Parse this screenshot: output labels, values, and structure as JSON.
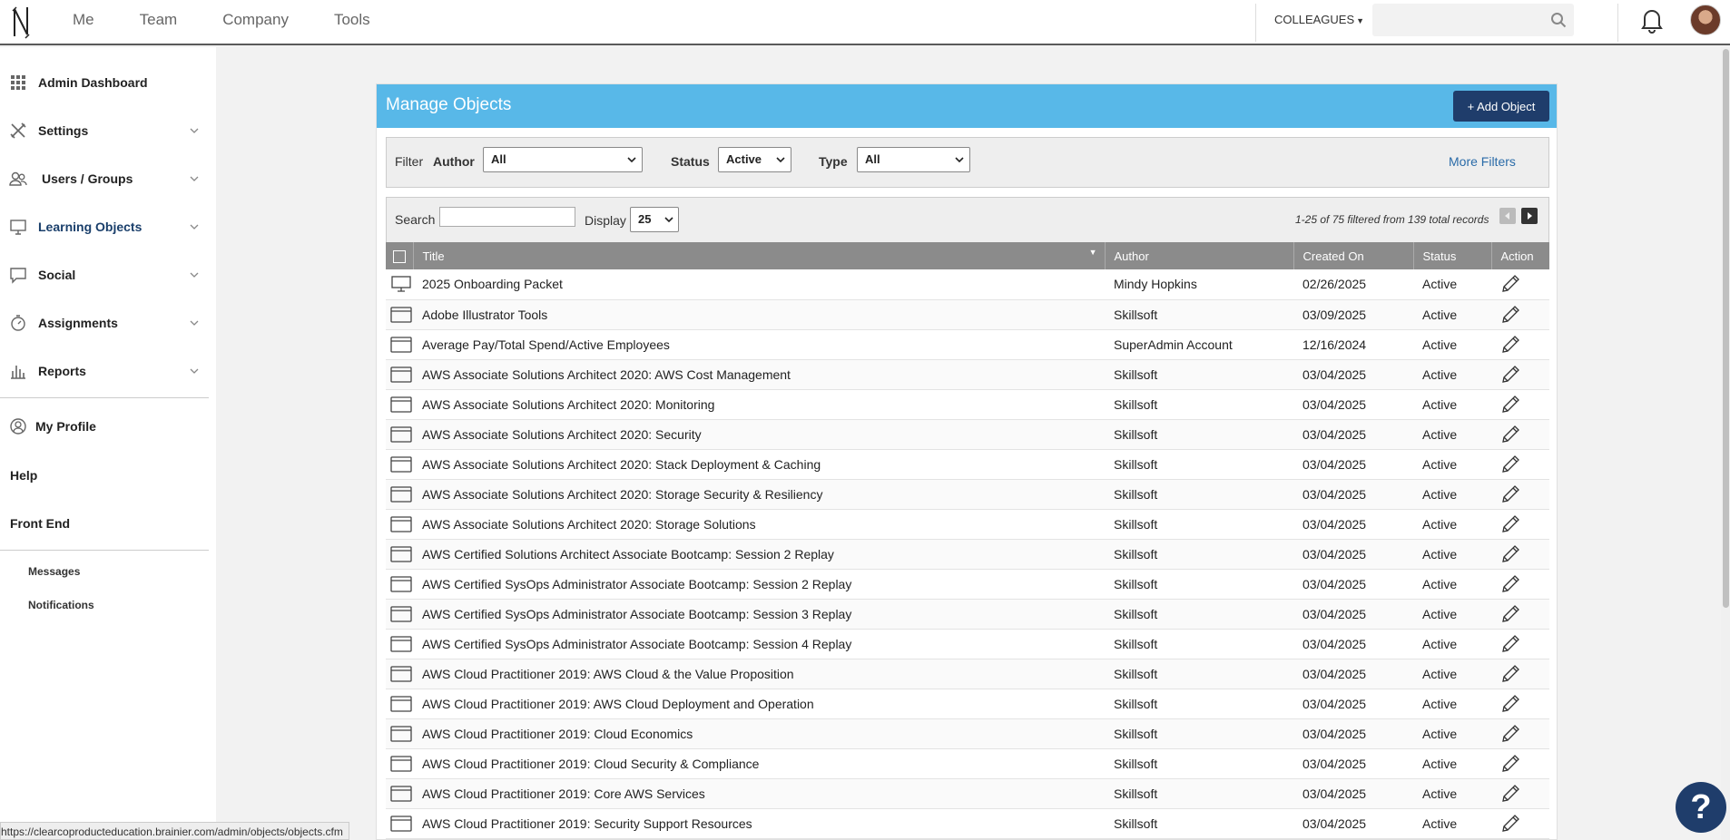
{
  "topnav": {
    "items": [
      "Me",
      "Team",
      "Company",
      "Tools"
    ],
    "colleagues_label": "COLLEAGUES",
    "search_placeholder": ""
  },
  "sidebar": {
    "items": [
      {
        "label": "Admin Dashboard",
        "icon": "grid-icon",
        "has_chevron": false
      },
      {
        "label": "Settings",
        "icon": "tools-icon",
        "has_chevron": true
      },
      {
        "label": "Users / Groups",
        "icon": "users-icon",
        "has_chevron": true
      },
      {
        "label": "Learning Objects",
        "icon": "monitor-icon",
        "has_chevron": true,
        "active": true
      },
      {
        "label": "Social",
        "icon": "chat-icon",
        "has_chevron": true
      },
      {
        "label": "Assignments",
        "icon": "stopwatch-icon",
        "has_chevron": true
      },
      {
        "label": "Reports",
        "icon": "bar-chart-icon",
        "has_chevron": true
      }
    ],
    "my_profile": "My Profile",
    "help": "Help",
    "front_end": "Front End",
    "messages": "Messages",
    "notifications": "Notifications"
  },
  "panel": {
    "title": "Manage Objects",
    "add_button": "+ Add Object",
    "filter": {
      "label": "Filter",
      "author_label": "Author",
      "author_value": "All",
      "status_label": "Status",
      "status_value": "Active",
      "type_label": "Type",
      "type_value": "All",
      "more_filters": "More Filters"
    },
    "search_label": "Search",
    "display_label": "Display",
    "display_value": "25",
    "records_text": "1-25 of 75 filtered from 139 total records"
  },
  "table": {
    "columns": [
      "Title",
      "Author",
      "Created On",
      "Status",
      "Action"
    ],
    "rows": [
      {
        "title": "2025 Onboarding Packet",
        "author": "Mindy Hopkins",
        "created": "02/26/2025",
        "status": "Active",
        "icon": "monitor-icon"
      },
      {
        "title": "Adobe Illustrator Tools",
        "author": "Skillsoft",
        "created": "03/09/2025",
        "status": "Active",
        "icon": "window-icon"
      },
      {
        "title": "Average Pay/Total Spend/Active Employees",
        "author": "SuperAdmin Account",
        "created": "12/16/2024",
        "status": "Active",
        "icon": "window-icon"
      },
      {
        "title": "AWS Associate Solutions Architect 2020: AWS Cost Management",
        "author": "Skillsoft",
        "created": "03/04/2025",
        "status": "Active",
        "icon": "window-icon"
      },
      {
        "title": "AWS Associate Solutions Architect 2020: Monitoring",
        "author": "Skillsoft",
        "created": "03/04/2025",
        "status": "Active",
        "icon": "window-icon"
      },
      {
        "title": "AWS Associate Solutions Architect 2020: Security",
        "author": "Skillsoft",
        "created": "03/04/2025",
        "status": "Active",
        "icon": "window-icon"
      },
      {
        "title": "AWS Associate Solutions Architect 2020: Stack Deployment & Caching",
        "author": "Skillsoft",
        "created": "03/04/2025",
        "status": "Active",
        "icon": "window-icon"
      },
      {
        "title": "AWS Associate Solutions Architect 2020: Storage Security & Resiliency",
        "author": "Skillsoft",
        "created": "03/04/2025",
        "status": "Active",
        "icon": "window-icon"
      },
      {
        "title": "AWS Associate Solutions Architect 2020: Storage Solutions",
        "author": "Skillsoft",
        "created": "03/04/2025",
        "status": "Active",
        "icon": "window-icon"
      },
      {
        "title": "AWS Certified Solutions Architect Associate Bootcamp: Session 2 Replay",
        "author": "Skillsoft",
        "created": "03/04/2025",
        "status": "Active",
        "icon": "window-icon"
      },
      {
        "title": "AWS Certified SysOps Administrator Associate Bootcamp: Session 2 Replay",
        "author": "Skillsoft",
        "created": "03/04/2025",
        "status": "Active",
        "icon": "window-icon"
      },
      {
        "title": "AWS Certified SysOps Administrator Associate Bootcamp: Session 3 Replay",
        "author": "Skillsoft",
        "created": "03/04/2025",
        "status": "Active",
        "icon": "window-icon"
      },
      {
        "title": "AWS Certified SysOps Administrator Associate Bootcamp: Session 4 Replay",
        "author": "Skillsoft",
        "created": "03/04/2025",
        "status": "Active",
        "icon": "window-icon"
      },
      {
        "title": "AWS Cloud Practitioner 2019: AWS Cloud & the Value Proposition",
        "author": "Skillsoft",
        "created": "03/04/2025",
        "status": "Active",
        "icon": "window-icon"
      },
      {
        "title": "AWS Cloud Practitioner 2019: AWS Cloud Deployment and Operation",
        "author": "Skillsoft",
        "created": "03/04/2025",
        "status": "Active",
        "icon": "window-icon"
      },
      {
        "title": "AWS Cloud Practitioner 2019: Cloud Economics",
        "author": "Skillsoft",
        "created": "03/04/2025",
        "status": "Active",
        "icon": "window-icon"
      },
      {
        "title": "AWS Cloud Practitioner 2019: Cloud Security & Compliance",
        "author": "Skillsoft",
        "created": "03/04/2025",
        "status": "Active",
        "icon": "window-icon"
      },
      {
        "title": "AWS Cloud Practitioner 2019: Core AWS Services",
        "author": "Skillsoft",
        "created": "03/04/2025",
        "status": "Active",
        "icon": "window-icon"
      },
      {
        "title": "AWS Cloud Practitioner 2019: Security Support Resources",
        "author": "Skillsoft",
        "created": "03/04/2025",
        "status": "Active",
        "icon": "window-icon"
      }
    ]
  },
  "status_url": "https://clearcoproducteducation.brainier.com/admin/objects/objects.cfm",
  "help_button": "?",
  "colors": {
    "header_blue": "#58b8e8",
    "brand_navy": "#1f3d6b",
    "table_header": "#8b8b8b",
    "link_blue": "#2a6ba8"
  }
}
